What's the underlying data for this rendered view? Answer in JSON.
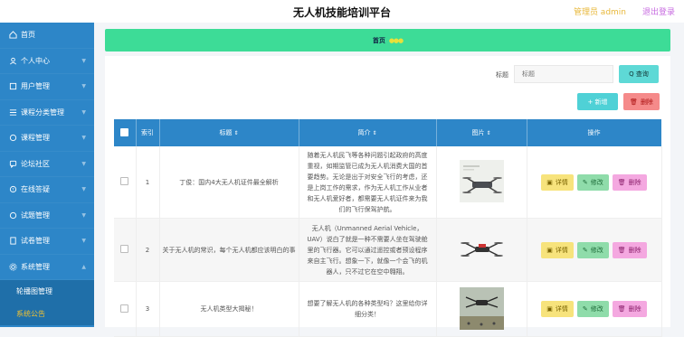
{
  "header": {
    "title": "无人机技能培训平台",
    "admin": "管理员 admin",
    "logout": "退出登录"
  },
  "sidebar": {
    "items": [
      {
        "label": "首页"
      },
      {
        "label": "个人中心"
      },
      {
        "label": "用户管理"
      },
      {
        "label": "课程分类管理"
      },
      {
        "label": "课程管理"
      },
      {
        "label": "论坛社区"
      },
      {
        "label": "在线答疑"
      },
      {
        "label": "试题管理"
      },
      {
        "label": "试卷管理"
      },
      {
        "label": "系统管理"
      }
    ],
    "subitems": [
      {
        "label": "轮播图管理"
      },
      {
        "label": "系统公告"
      }
    ]
  },
  "breadcrumb": {
    "label": "首页",
    "decoration": "●●●"
  },
  "search": {
    "label": "标题",
    "placeholder": "标题",
    "button": "Q 查询"
  },
  "actions": {
    "add": "+ 新增",
    "delete": "删除"
  },
  "table": {
    "headers": {
      "index": "索引",
      "title": "标题",
      "intro": "简介",
      "image": "图片",
      "ops": "操作"
    },
    "sort_glyph": "⇕",
    "rows": [
      {
        "index": "1",
        "title": "丁俊：国内4大无人机证件最全解析",
        "intro": "随着无人机民飞等各种问题引起政府的高度重视，如期监管已成为无人机消费大国的首要趋势。无论是出于对安全飞行的考虑，还是上岗工作的需求，作为无人机工作从业者和无人机爱好者，都需要无人机证件来为我们的飞行保驾护航。"
      },
      {
        "index": "2",
        "title": "关于无人机的常识，每个无人机都应该明白的事",
        "intro": "无人机（Unmanned Aerial Vehicle，UAV）说白了就是一种不需要人坐在驾驶舱里的飞行器。它可以通过遥控或者预设程序来自主飞行。想象一下，就像一个会飞的机器人，只不过它在空中翱翔。"
      },
      {
        "index": "3",
        "title": "无人机类型大揭秘！",
        "intro": "想要了解无人机的各种类型吗？这里给你详细分类！"
      }
    ],
    "op_labels": {
      "detail": "详情",
      "edit": "修改",
      "remove": "删除"
    }
  }
}
